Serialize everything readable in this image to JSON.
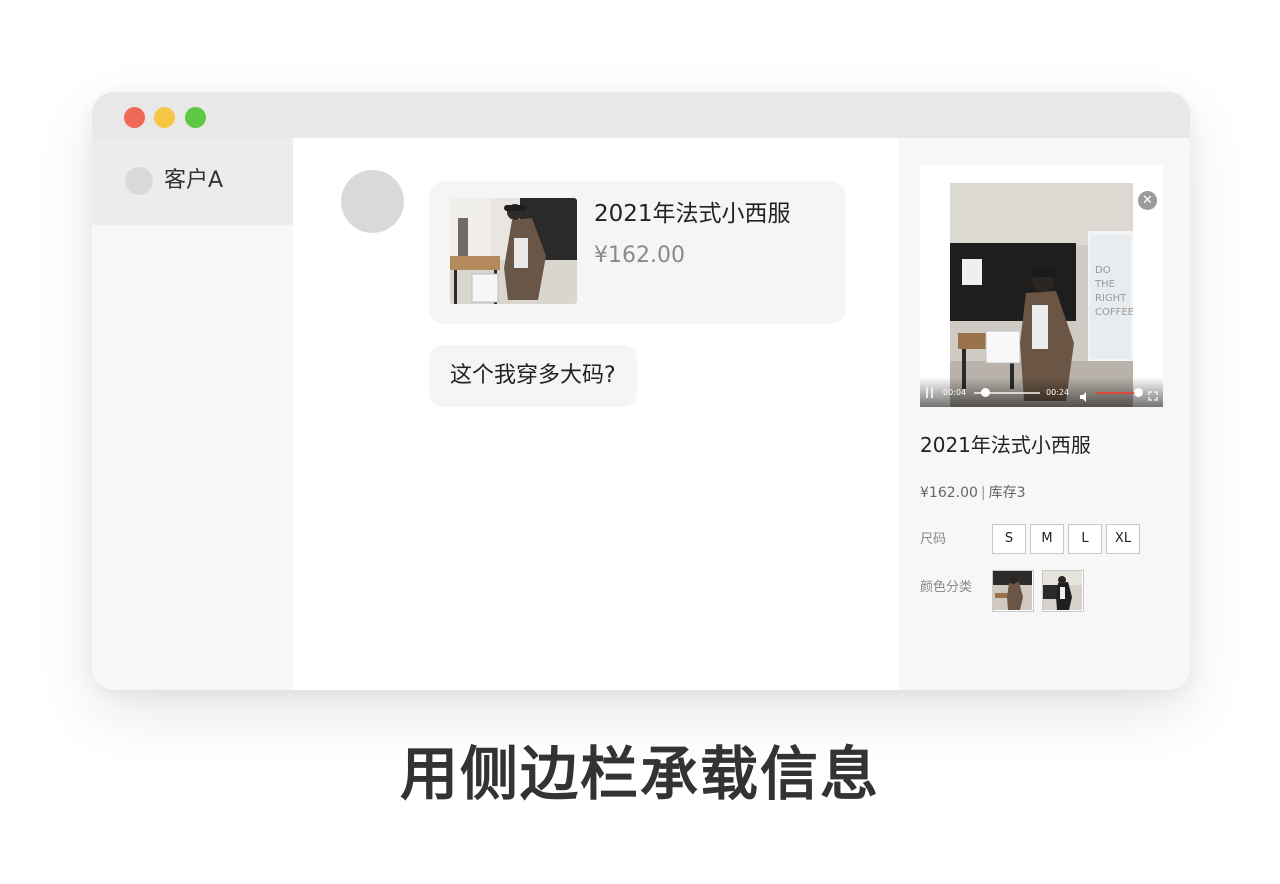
{
  "window": {
    "traffic_lights": {
      "close_color": "#ee6a56",
      "minimize_color": "#f6c744",
      "zoom_color": "#5cc844"
    }
  },
  "sidebar": {
    "customers": [
      {
        "name": "客户A",
        "selected": true
      }
    ]
  },
  "chat": {
    "product_card": {
      "title": "2021年法式小西服",
      "price": "¥162.00"
    },
    "messages": [
      {
        "text": "这个我穿多大码?"
      }
    ]
  },
  "detail_panel": {
    "video": {
      "current_time": "00:04",
      "total_time": "00:24",
      "progress": 0.17,
      "volume": 0.9
    },
    "title": "2021年法式小西服",
    "price": "¥162.00",
    "separator": "|",
    "stock": "库存3",
    "size_label": "尺码",
    "sizes": [
      "S",
      "M",
      "L",
      "XL"
    ],
    "color_label": "颜色分类",
    "color_options": [
      {
        "name": "color-option-1"
      },
      {
        "name": "color-option-2"
      }
    ]
  },
  "caption": "用侧边栏承载信息",
  "colors": {
    "accent_red": "#e0463c",
    "bubble_bg": "#f5f5f5",
    "avatar_gray": "#d9d9d9"
  }
}
